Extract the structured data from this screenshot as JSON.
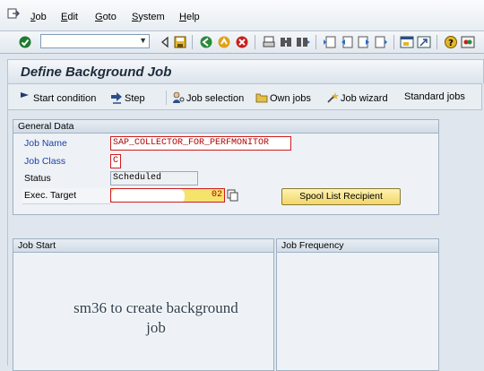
{
  "menu": {
    "items": [
      {
        "label": "Job",
        "underline": "J"
      },
      {
        "label": "Edit",
        "underline": "E"
      },
      {
        "label": "Goto",
        "underline": "G"
      },
      {
        "label": "System",
        "underline": "S"
      },
      {
        "label": "Help",
        "underline": "H"
      }
    ]
  },
  "toolbar": {
    "command_field": {
      "value": "",
      "placeholder": ""
    }
  },
  "screen": {
    "title": "Define Background Job"
  },
  "app_toolbar": {
    "start_condition": "Start condition",
    "step": "Step",
    "job_selection": "Job selection",
    "own_jobs": "Own jobs",
    "job_wizard": "Job wizard",
    "standard_jobs": "Standard jobs"
  },
  "general_data": {
    "header": "General Data",
    "job_name_label": "Job Name",
    "job_name_value": "SAP_COLLECTOR_FOR_PERFMONITOR",
    "job_class_label": "Job Class",
    "job_class_value": "C",
    "status_label": "Status",
    "status_value": "Scheduled",
    "exec_target_label": "Exec. Target",
    "exec_target_visible": "02",
    "spool_button": "Spool List Recipient"
  },
  "job_start": {
    "header": "Job Start"
  },
  "job_frequency": {
    "header": "Job Frequency"
  },
  "overlay": {
    "caption_line1": "sm36 to create background",
    "caption_line2": "job"
  },
  "colors": {
    "accent_red": "#d01c1c",
    "field_yellow": "#f5e36b",
    "label_blue": "#1a3ea8"
  }
}
